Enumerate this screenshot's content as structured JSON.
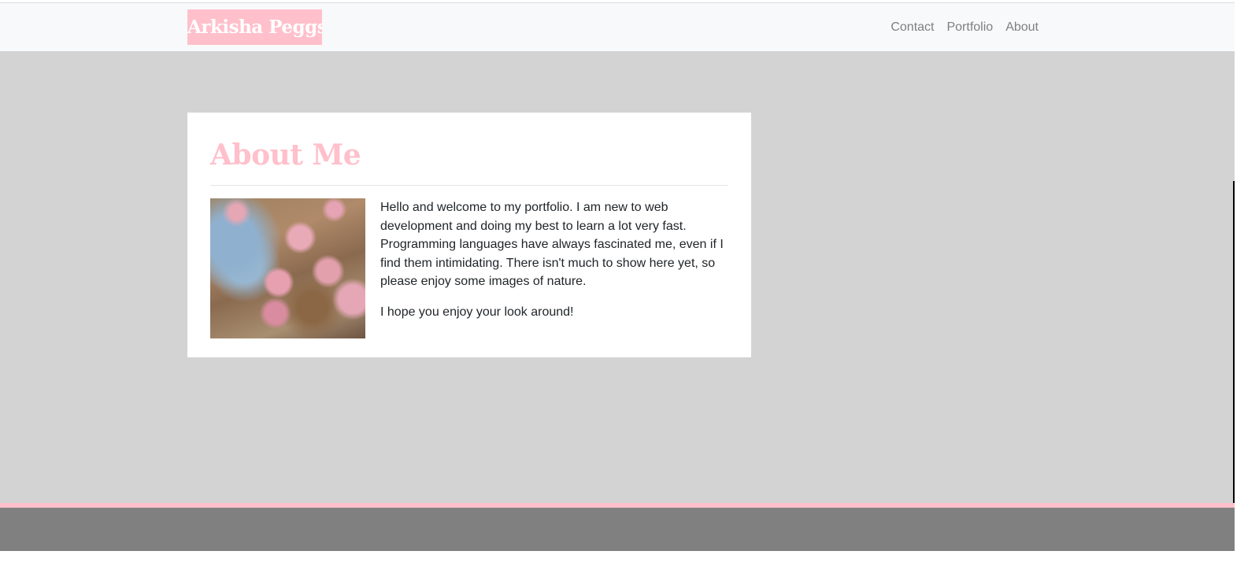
{
  "navbar": {
    "brand": "Arkisha Peggs",
    "links": [
      {
        "label": "Contact"
      },
      {
        "label": "Portfolio"
      },
      {
        "label": "About"
      }
    ]
  },
  "about": {
    "title": "About Me",
    "image_alt": "pink roses photo",
    "paragraphs": [
      "Hello and welcome to my portfolio. I am new to web development and doing my best to learn a lot very fast. Programming languages have always fascinated me, even if I find them intimidating. There isn't much to show here yet, so please enjoy some images of nature.",
      "I hope you enjoy your look around!"
    ]
  },
  "colors": {
    "accent": "#ffc0cb",
    "navbar_bg": "#f8f9fa",
    "main_bg": "#d3d3d3",
    "footer_bg": "#808080",
    "nav_text": "#7f7f7f"
  }
}
